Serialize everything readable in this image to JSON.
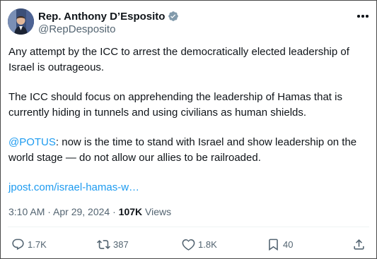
{
  "author": {
    "name": "Rep. Anthony D’Esposito",
    "handle": "@RepDesposito"
  },
  "tweet": {
    "paragraphs": [
      [
        {
          "text": "Any attempt by the ICC to arrest the democratically elected leadership of Israel is outrageous."
        }
      ],
      [
        {
          "text": "The ICC should focus on apprehending the leadership of Hamas that is currently hiding in tunnels and using civilians as human shields."
        }
      ],
      [
        {
          "text": "@POTUS",
          "link": true
        },
        {
          "text": ": now is the time to stand with Israel and show leadership on the world stage — do not allow our allies to be railroaded."
        }
      ],
      [
        {
          "text": "jpost.com/israel-hamas-w…",
          "link": true
        }
      ]
    ],
    "timestamp": "3:10 AM · Apr 29, 2024 · ",
    "views_count": "107K",
    "views_label": " Views"
  },
  "actions": {
    "replies": "1.7K",
    "reposts": "387",
    "likes": "1.8K",
    "bookmarks": "40"
  },
  "colors": {
    "link": "#1d9bf0",
    "secondary_text": "#536471",
    "verified": "#829aab"
  }
}
